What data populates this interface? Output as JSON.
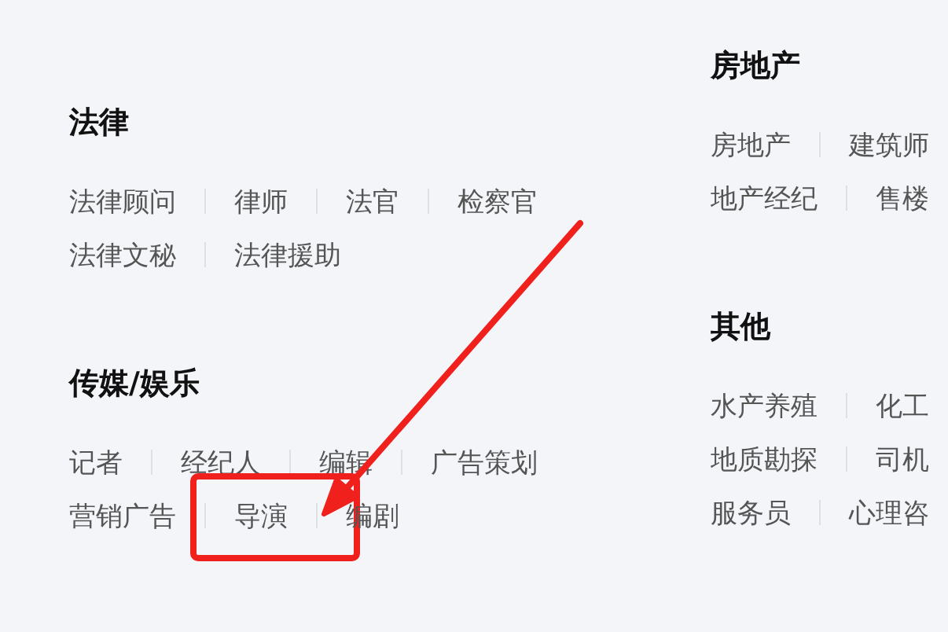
{
  "columns": [
    {
      "sections": [
        {
          "title": "法律",
          "rows": [
            [
              {
                "label": "法律顾问",
                "highlighted": false
              },
              {
                "label": "律师",
                "highlighted": false
              },
              {
                "label": "法官",
                "highlighted": false
              },
              {
                "label": "检察官",
                "highlighted": false
              }
            ],
            [
              {
                "label": "法律文秘",
                "highlighted": false
              },
              {
                "label": "法律援助",
                "highlighted": false
              }
            ]
          ]
        },
        {
          "title": "传媒/娱乐",
          "rows": [
            [
              {
                "label": "记者",
                "highlighted": false
              },
              {
                "label": "经纪人",
                "highlighted": false
              },
              {
                "label": "编辑",
                "highlighted": false
              },
              {
                "label": "广告策划",
                "highlighted": false
              }
            ],
            [
              {
                "label": "营销广告",
                "highlighted": false
              },
              {
                "label": "导演",
                "highlighted": true
              },
              {
                "label": "编剧",
                "highlighted": false
              }
            ]
          ]
        }
      ]
    },
    {
      "sections": [
        {
          "title": "房地产",
          "rows": [
            [
              {
                "label": "房地产",
                "highlighted": false
              },
              {
                "label": "建筑师",
                "highlighted": false
              }
            ],
            [
              {
                "label": "地产经纪",
                "highlighted": false
              },
              {
                "label": "售楼",
                "highlighted": false
              }
            ]
          ]
        },
        {
          "title": "其他",
          "rows": [
            [
              {
                "label": "水产养殖",
                "highlighted": false
              },
              {
                "label": "化工",
                "highlighted": false
              }
            ],
            [
              {
                "label": "地质勘探",
                "highlighted": false
              },
              {
                "label": "司机",
                "highlighted": false
              }
            ],
            [
              {
                "label": "服务员",
                "highlighted": false
              },
              {
                "label": "心理咨",
                "highlighted": false
              }
            ]
          ]
        }
      ]
    }
  ]
}
